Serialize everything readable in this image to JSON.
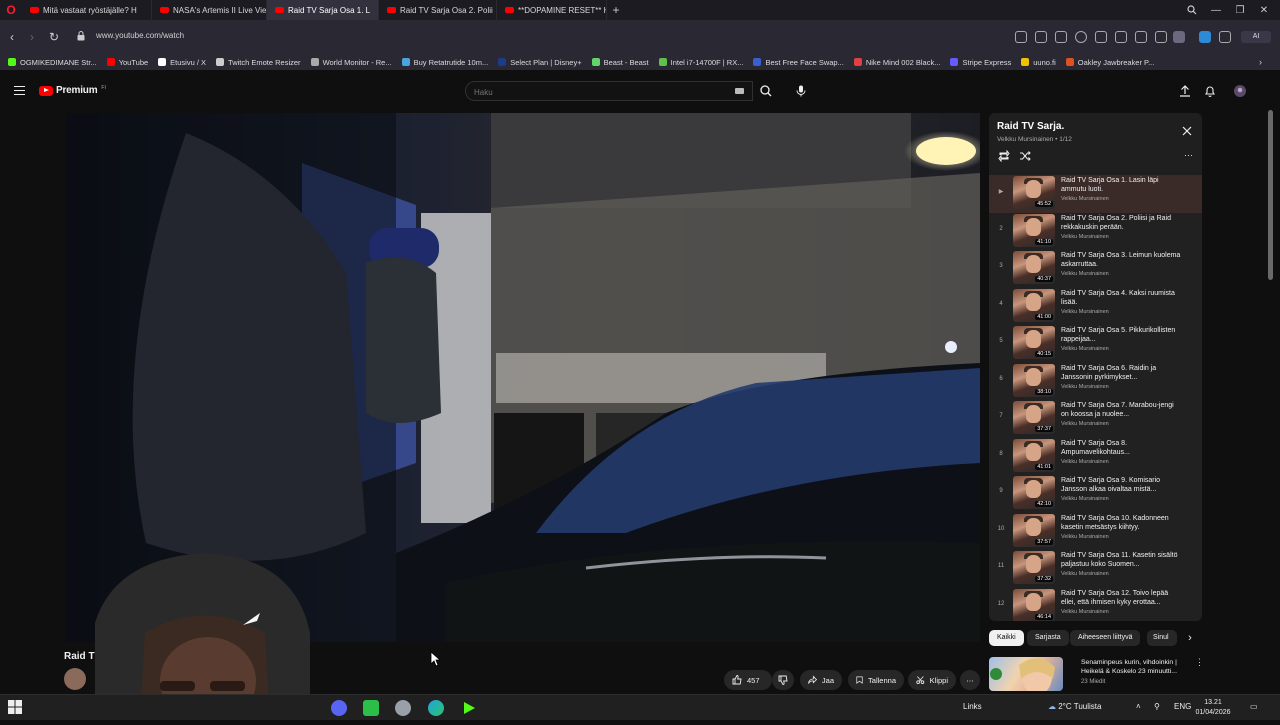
{
  "browser": {
    "tabs": [
      {
        "label": "Mitä vastaat ryöstäjälle? H",
        "active": false
      },
      {
        "label": "NASA's Artemis II Live Vie",
        "active": false
      },
      {
        "label": "Raid TV Sarja Osa 1. L",
        "active": true
      },
      {
        "label": "Raid TV Sarja Osa 2. Polii",
        "active": false
      },
      {
        "label": "**DOPAMINE RESET** Hap",
        "active": false
      }
    ],
    "url": "www.youtube.com/watch",
    "bookmarks": [
      {
        "label": "OGMIKEDIMANE Str...",
        "color": "#53fc18"
      },
      {
        "label": "YouTube",
        "color": "#ff0000"
      },
      {
        "label": "Etusivu / X",
        "color": "#ffffff"
      },
      {
        "label": "Twitch Emote Resizer",
        "color": "#cccccc"
      },
      {
        "label": "World Monitor - Re...",
        "color": "#aaaaaa"
      },
      {
        "label": "Buy Retatrutide 10m...",
        "color": "#4aa3df"
      },
      {
        "label": "Select Plan | Disney+",
        "color": "#1a3c8a"
      },
      {
        "label": "Beast - Beast",
        "color": "#63d46a"
      },
      {
        "label": "Intel i7-14700F | RX...",
        "color": "#5fbf4a"
      },
      {
        "label": "Best Free Face Swap...",
        "color": "#3a5fcf"
      },
      {
        "label": "Nike Mind 002 Black...",
        "color": "#e04040"
      },
      {
        "label": "Stripe Express",
        "color": "#635bff"
      },
      {
        "label": "uuno.fi",
        "color": "#f2c200"
      },
      {
        "label": "Oakley Jawbreaker P...",
        "color": "#e05020"
      }
    ]
  },
  "youtube": {
    "logo_text": "Premium",
    "logo_sup": "FI",
    "search_placeholder": "Haku"
  },
  "playlist": {
    "title": "Raid TV Sarja.",
    "subtitle": "Velkku Mursinainen • 1/12",
    "items": [
      {
        "index": "▶",
        "title": "Raid TV Sarja Osa 1. Lasin läpi ammutu luoti.",
        "channel": "Velkku Mursinainen",
        "duration": "45:52"
      },
      {
        "index": "2",
        "title": "Raid TV Sarja Osa 2. Poliisi ja Raid rekkakuskin perään.",
        "channel": "Velkku Mursinainen",
        "duration": "41:10"
      },
      {
        "index": "3",
        "title": "Raid TV Sarja Osa 3. Leimun kuolema askarruttaa.",
        "channel": "Velkku Mursinainen",
        "duration": "40:37"
      },
      {
        "index": "4",
        "title": "Raid TV Sarja Osa 4. Kaksi ruumista lisää.",
        "channel": "Velkku Mursinainen",
        "duration": "41:00"
      },
      {
        "index": "5",
        "title": "Raid TV Sarja Osa 5. Pikkurikollisten rappeijaa...",
        "channel": "Velkku Mursinainen",
        "duration": "40:15"
      },
      {
        "index": "6",
        "title": "Raid TV Sarja Osa 6. Raidin ja Janssonin pyrkimykset...",
        "channel": "Velkku Mursinainen",
        "duration": "38:10"
      },
      {
        "index": "7",
        "title": "Raid TV Sarja Osa 7. Marabou-jengi on koossa ja nuolee...",
        "channel": "Velkku Mursinainen",
        "duration": "37:37"
      },
      {
        "index": "8",
        "title": "Raid TV Sarja Osa 8. Ampumavelikohtaus...",
        "channel": "Velkku Mursinainen",
        "duration": "41:01"
      },
      {
        "index": "9",
        "title": "Raid TV Sarja Osa 9. Komisario Jansson alkaa oivaltaa mistä...",
        "channel": "Velkku Mursinainen",
        "duration": "42:10"
      },
      {
        "index": "10",
        "title": "Raid TV Sarja Osa 10. Kadonneen kasetin metsästys kiihtyy.",
        "channel": "Velkku Mursinainen",
        "duration": "37:57"
      },
      {
        "index": "11",
        "title": "Raid TV Sarja Osa 11. Kasetin sisältö paljastuu koko Suomen...",
        "channel": "Velkku Mursinainen",
        "duration": "37:32"
      },
      {
        "index": "12",
        "title": "Raid TV Sarja Osa 12. Toivo lepää ellei, että ihmisen kyky erottaa...",
        "channel": "Velkku Mursinainen",
        "duration": "46:14"
      }
    ]
  },
  "chips": [
    "Kaikki",
    "Sarjasta",
    "Aiheeseen liittyvä",
    "Sinul"
  ],
  "related": {
    "title": "Senaminpeus kurin, vihdoinkin | Heikelä & Koskelo 23 minuutti...",
    "meta": "23 Miedit"
  },
  "video": {
    "title_fragment": "Raid T",
    "likes": "457",
    "share": "Jaa",
    "save": "Tallenna",
    "clip": "Klippi"
  },
  "taskbar": {
    "links": "Links",
    "weather": "2°C  Tuulista",
    "lang": "ENG",
    "time": "13.21",
    "date": "01/04/2026"
  },
  "colors": {
    "accent": "#ff0000",
    "background": "#0f0f0f",
    "panel": "#212121"
  }
}
